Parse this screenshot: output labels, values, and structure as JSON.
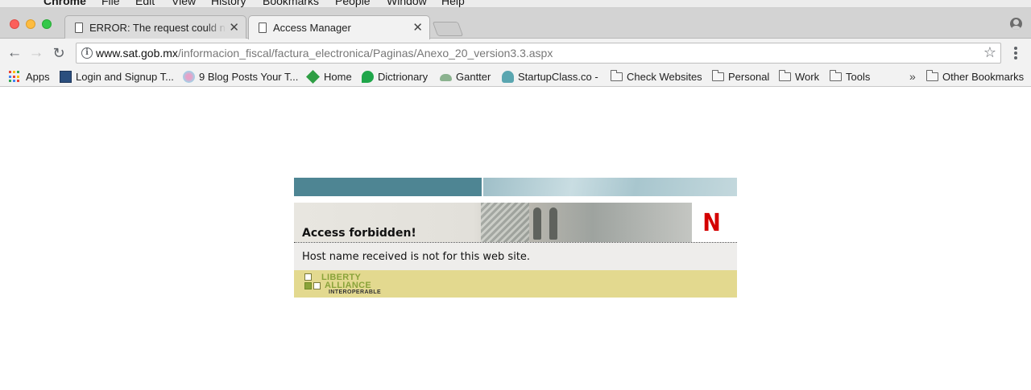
{
  "menubar": {
    "app": "Chrome",
    "items": [
      "File",
      "Edit",
      "View",
      "History",
      "Bookmarks",
      "People",
      "Window",
      "Help"
    ]
  },
  "tabs": [
    {
      "title": "ERROR: The request could not be satisfied",
      "active": false
    },
    {
      "title": "Access Manager",
      "active": true
    }
  ],
  "toolbar": {
    "url_host": "www.sat.gob.mx",
    "url_path": "/informacion_fiscal/factura_electronica/Paginas/Anexo_20_version3.3.aspx"
  },
  "bookmarks": {
    "items": [
      {
        "label": "Apps",
        "icon": "apps-grid-icon"
      },
      {
        "label": "Login and Signup T...",
        "icon": "site-favicon"
      },
      {
        "label": "9 Blog Posts Your T...",
        "icon": "site-favicon"
      },
      {
        "label": "Home",
        "icon": "site-favicon"
      },
      {
        "label": "Dictrionary",
        "icon": "speech-bubble-icon"
      },
      {
        "label": "Gantter",
        "icon": "cloud-icon"
      },
      {
        "label": "StartupClass.co -",
        "icon": "site-favicon"
      },
      {
        "label": "Check Websites",
        "icon": "folder-icon"
      },
      {
        "label": "Personal",
        "icon": "folder-icon"
      },
      {
        "label": "Work",
        "icon": "folder-icon"
      },
      {
        "label": "Tools",
        "icon": "folder-icon"
      }
    ],
    "overflow": "»",
    "other": "Other Bookmarks"
  },
  "page": {
    "heading": "Access forbidden!",
    "message": "Host name received is not for this web site.",
    "brand_logo_letter": "N",
    "footer_logo": {
      "line1": "LIBERTY",
      "line2": "ALLIANCE",
      "line3": "INTEROPERABLE"
    }
  },
  "colors": {
    "banner_teal": "#4e8593",
    "footer_khaki": "#e3d98f",
    "brand_red": "#d40000"
  }
}
